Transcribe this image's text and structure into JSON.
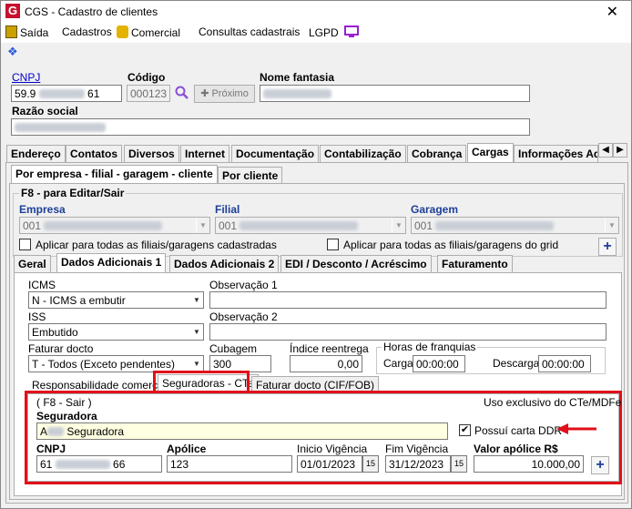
{
  "window": {
    "title": "CGS - Cadastro de clientes",
    "close": "✕"
  },
  "menu": {
    "saida": "Saída",
    "cadastros": "Cadastros",
    "comercial": "Comercial",
    "consultas": "Consultas cadastrais",
    "lgpd": "LGPD"
  },
  "header": {
    "cnpj_label": "CNPJ",
    "cnpj_prefix": "59.9",
    "cnpj_suffix": "61",
    "codigo_label": "Código",
    "codigo_value": "000123",
    "proximo_label": "Próximo",
    "nome_fantasia_label": "Nome fantasia",
    "razao_social_label": "Razão social"
  },
  "main_tabs": [
    "Endereço",
    "Contatos",
    "Diversos",
    "Internet",
    "Documentação",
    "Contabilização",
    "Cobrança",
    "Cargas",
    "Informações Adi"
  ],
  "main_tab_active": "Cargas",
  "cargas_tabs": [
    "Por empresa - filial - garagem - cliente",
    "Por cliente"
  ],
  "f8_caption": "F8 - para Editar/Sair",
  "empresa": {
    "label": "Empresa",
    "value": "001"
  },
  "filial": {
    "label": "Filial",
    "value": "001"
  },
  "garagem": {
    "label": "Garagem",
    "value": "001"
  },
  "aplicar_todas": "Aplicar para todas as filiais/garagens cadastradas",
  "aplicar_grid": "Aplicar para todas as filiais/garagens do grid",
  "sub_tabs": [
    "Geral",
    "Dados Adicionais 1",
    "Dados Adicionais 2",
    "EDI / Desconto / Acréscimo",
    "Faturamento"
  ],
  "icms": {
    "label": "ICMS",
    "value": "N - ICMS a embutir"
  },
  "observacao1_label": "Observação 1",
  "iss": {
    "label": "ISS",
    "value": "Embutido"
  },
  "observacao2_label": "Observação 2",
  "faturar": {
    "label": "Faturar docto",
    "value": "T - Todos (Exceto pendentes)"
  },
  "cubagem": {
    "label": "Cubagem",
    "value": "300"
  },
  "indice": {
    "label": "Índice reentrega",
    "value": "0,00"
  },
  "franquias": {
    "label": "Horas de franquias",
    "carga_label": "Carga",
    "carga_value": "00:00:00",
    "descarga_label": "Descarga",
    "descarga_value": "00:00:00"
  },
  "inner_tabs": [
    "Responsabilidade comercial",
    "Seguradoras - CTe",
    "Faturar docto (CIF/FOB)"
  ],
  "seg": {
    "f8": "( F8 - Sair )",
    "uso": "Uso exclusivo do CTe/MDFe",
    "seguradora_label": "Seguradora",
    "seguradora_prefix": "A",
    "seguradora_suffix": "Seguradora",
    "possui_ddr": "Possuí carta DDR",
    "cnpj_label": "CNPJ",
    "cnpj_prefix": "61",
    "cnpj_suffix": "66",
    "apolice_label": "Apólice",
    "apolice_value": "123",
    "inicio_label": "Inicio Vigência",
    "inicio_value": "01/01/2023",
    "fim_label": "Fim Vigência",
    "fim_value": "31/12/2023",
    "valor_label": "Valor apólice R$",
    "valor_value": "10.000,00"
  },
  "colors": {
    "accent_red": "#e0101a",
    "link_blue": "#0000cc"
  }
}
